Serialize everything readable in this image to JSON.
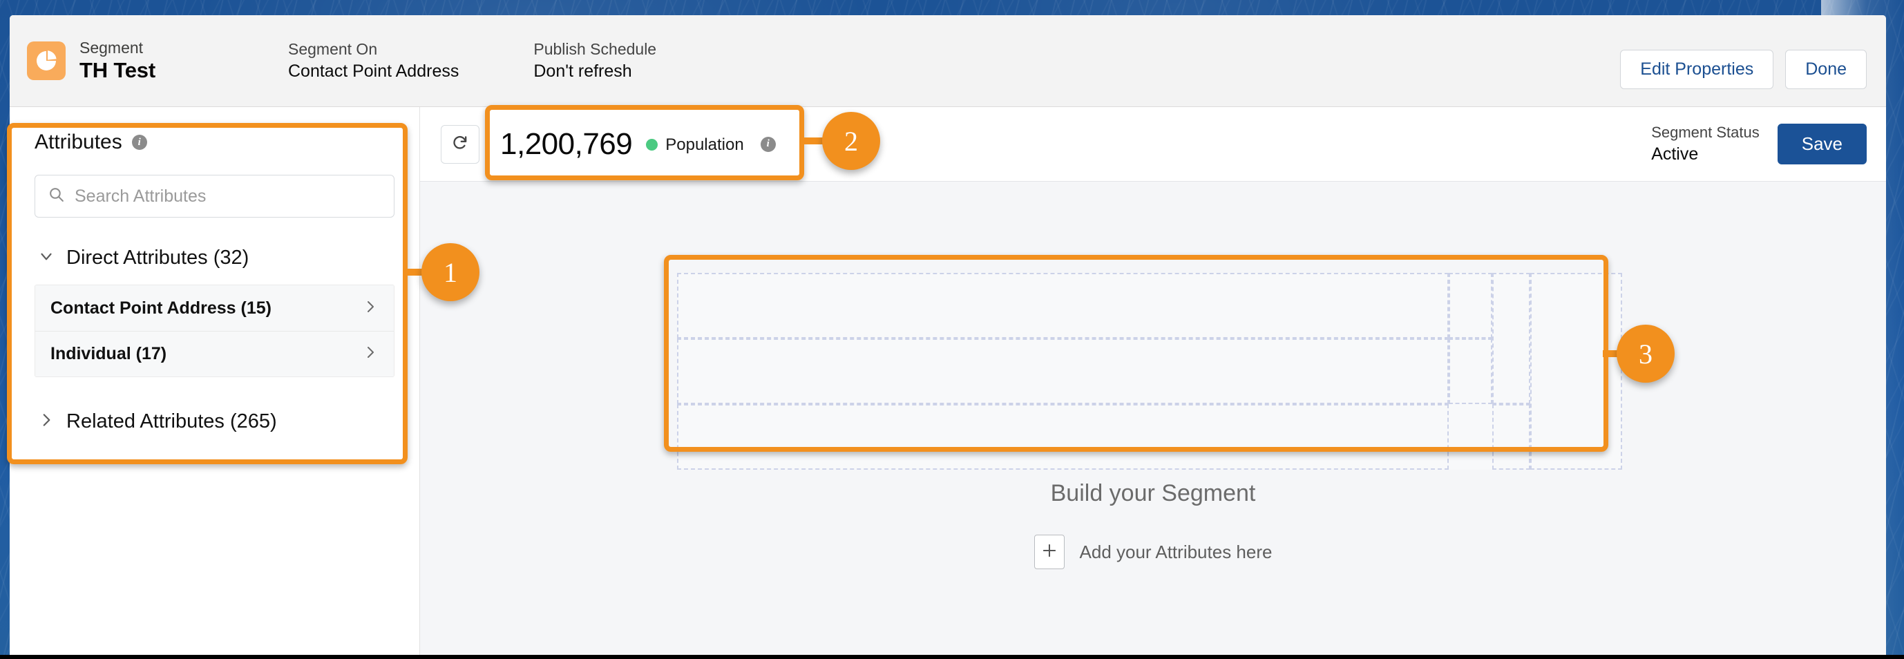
{
  "header": {
    "app_icon": "segment-pie-icon",
    "kicker": "Segment",
    "title": "TH Test",
    "meta": [
      {
        "label": "Segment On",
        "value": "Contact Point Address"
      },
      {
        "label": "Publish Schedule",
        "value": "Don't refresh"
      }
    ],
    "edit_properties_label": "Edit Properties",
    "done_label": "Done"
  },
  "sidebar": {
    "title": "Attributes",
    "info_icon": "info-icon",
    "search": {
      "placeholder": "Search Attributes",
      "value": "",
      "icon": "search-icon"
    },
    "groups": [
      {
        "label": "Direct Attributes (32)",
        "expanded": true,
        "chevron": "chevron-down-icon",
        "items": [
          {
            "label": "Contact Point Address (15)",
            "chevron": "chevron-right-icon"
          },
          {
            "label": "Individual (17)",
            "chevron": "chevron-right-icon"
          }
        ]
      },
      {
        "label": "Related Attributes (265)",
        "expanded": false,
        "chevron": "chevron-right-icon",
        "items": []
      }
    ]
  },
  "canvas": {
    "refresh_icon": "refresh-icon",
    "population": {
      "count": "1,200,769",
      "legend_label": "Population",
      "legend_dot_color": "#4bca81",
      "bar_color": "#4bca81",
      "bar_percent": 100,
      "info_icon": "info-icon"
    },
    "status": {
      "label": "Segment Status",
      "value": "Active"
    },
    "save_label": "Save",
    "empty_state": {
      "title": "Build your Segment",
      "add_icon": "plus-icon",
      "subtitle": "Add your Attributes here"
    }
  },
  "annotations": {
    "accent_color": "#f2901e",
    "badges": [
      {
        "number": "1",
        "target": "attributes-panel"
      },
      {
        "number": "2",
        "target": "population-summary"
      },
      {
        "number": "3",
        "target": "segment-canvas-placeholder"
      }
    ]
  }
}
